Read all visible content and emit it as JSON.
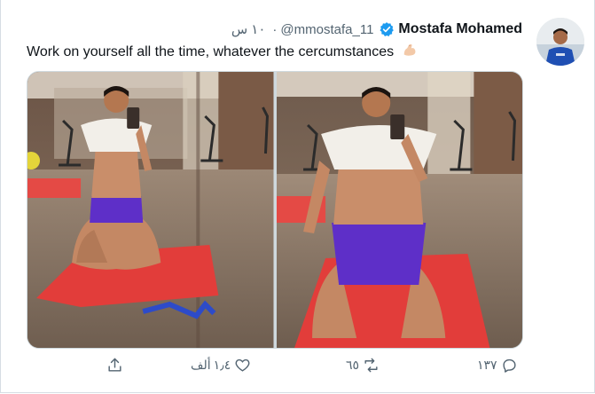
{
  "tweet": {
    "author_name": "Mostafa Mohamed",
    "handle": "@mmostafa_11",
    "time": "١٠ س",
    "separator": "·",
    "text": "Work on yourself all the time, whatever the cercumstances",
    "emoji": "flexed-biceps-icon",
    "photos": [
      "gym-selfie-1",
      "gym-selfie-2"
    ]
  },
  "actions": {
    "reply_count": "١٣٧",
    "retweet_count": "٦٥",
    "like_count": "١٫٤",
    "like_unit": "ألف"
  },
  "colors": {
    "text": "#0f1419",
    "secondary": "#536471",
    "verified": "#1d9bf0",
    "mat": "#e53b3b",
    "shorts": "#5a2fd0"
  }
}
